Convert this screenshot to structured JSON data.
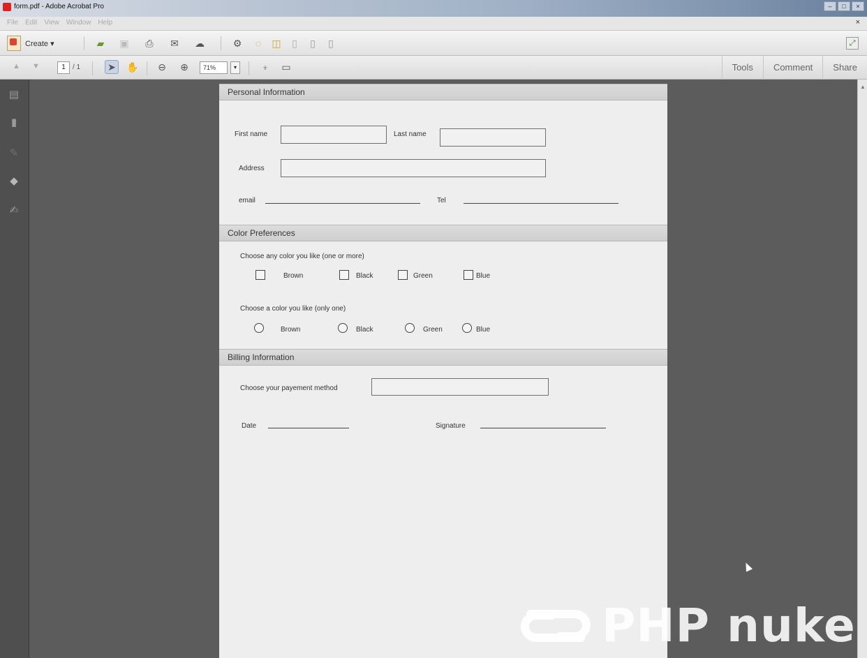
{
  "window": {
    "title": "form.pdf - Adobe Acrobat Pro",
    "menu": [
      "File",
      "Edit",
      "View",
      "Window",
      "Help"
    ],
    "close_glyph": "×"
  },
  "toolbar": {
    "create_label": "Create ▾",
    "icons": [
      "open-folder-icon",
      "save-icon",
      "print-icon",
      "email-icon",
      "cloud-icon",
      "settings-icon",
      "comment-icon",
      "sticky-note-icon",
      "document-icon",
      "document-export-icon",
      "document-edit-icon"
    ]
  },
  "navbar": {
    "page_current": "1",
    "page_total": "/ 1",
    "zoom": "71%",
    "right_tabs": [
      "Tools",
      "Comment",
      "Share"
    ]
  },
  "form": {
    "personal": {
      "heading": "Personal Information",
      "first_name": "First name",
      "last_name": "Last name",
      "address": "Address",
      "email": "email",
      "tel": "Tel"
    },
    "color": {
      "heading": "Color Preferences",
      "checkbox_prompt": "Choose any color you like (one or more)",
      "radio_prompt": "Choose a color you like (only one)",
      "options": [
        "Brown",
        "Black",
        "Green",
        "Blue"
      ]
    },
    "billing": {
      "heading": "Billing Information",
      "payment": "Choose your payement method",
      "date": "Date",
      "signature": "Signature"
    }
  },
  "watermark": {
    "text": "PHP nuke"
  }
}
